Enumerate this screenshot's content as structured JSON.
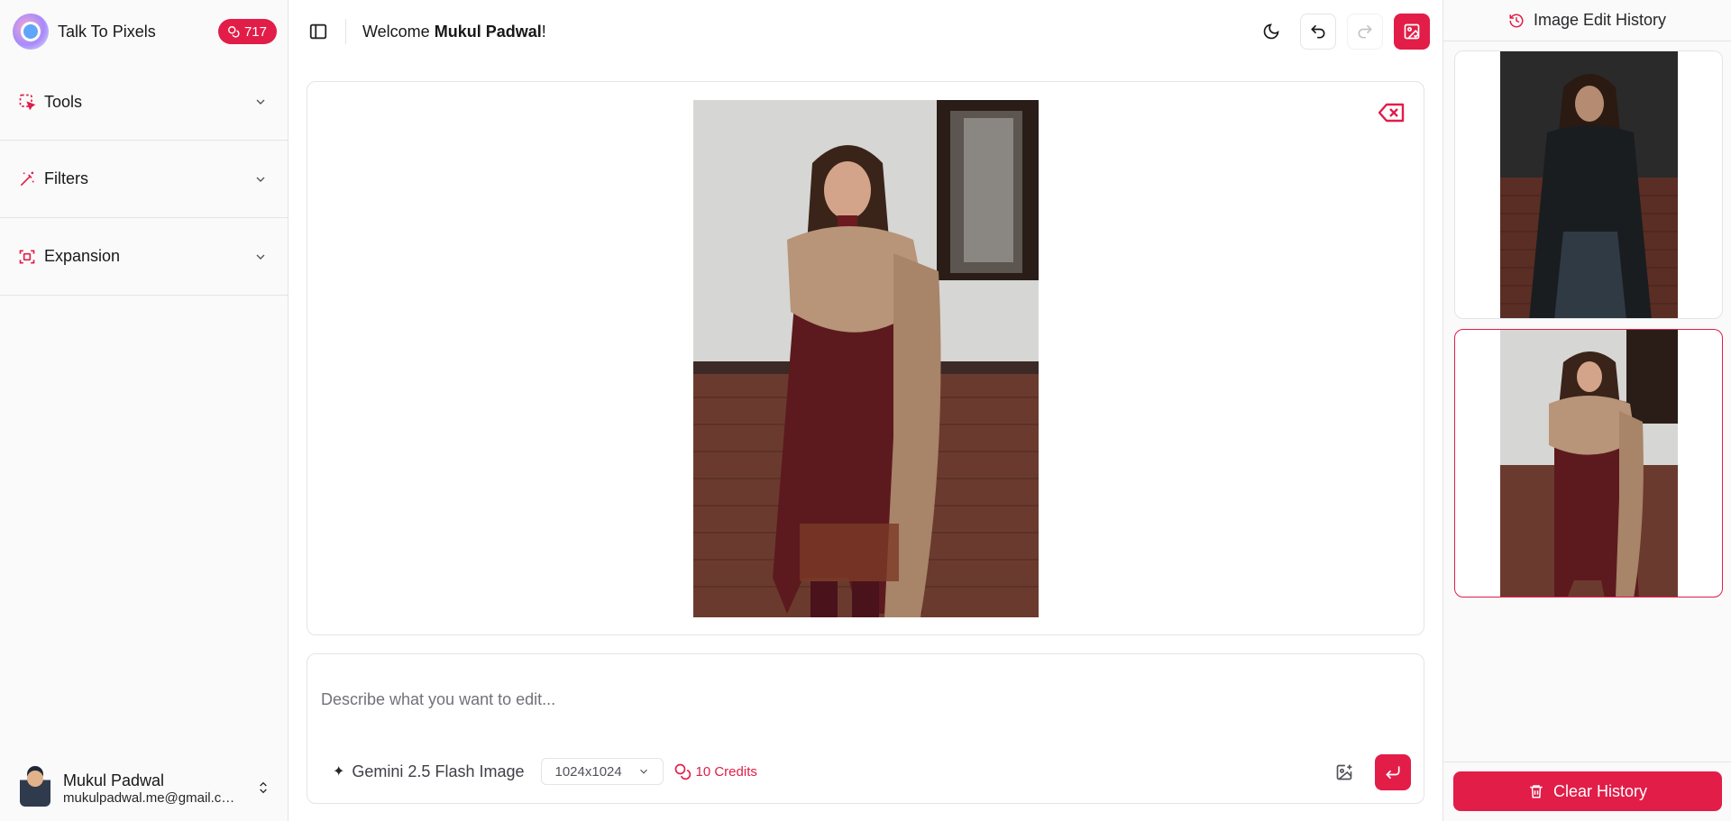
{
  "app": {
    "name": "Talk To Pixels",
    "credits_balance": "717"
  },
  "sidebar": {
    "sections": [
      {
        "label": "Tools",
        "icon": "selection-icon"
      },
      {
        "label": "Filters",
        "icon": "magic-wand-icon"
      },
      {
        "label": "Expansion",
        "icon": "expand-frame-icon"
      }
    ]
  },
  "user": {
    "name": "Mukul Padwal",
    "email": "mukulpadwal.me@gmail.com"
  },
  "header": {
    "welcome_prefix": "Welcome ",
    "welcome_name": "Mukul Padwal",
    "welcome_suffix": "!"
  },
  "prompt": {
    "placeholder": "Describe what you want to edit...",
    "model": "Gemini 2.5 Flash Image",
    "size": "1024x1024",
    "cost": "10 Credits"
  },
  "history": {
    "title": "Image Edit History",
    "items": [
      {
        "description": "woman in dark jacket",
        "selected": false
      },
      {
        "description": "woman in embroidered shawl",
        "selected": true
      }
    ],
    "clear_label": "Clear History"
  },
  "colors": {
    "accent": "#e11d48",
    "border": "#e4e4e7",
    "sidebar_bg": "#fafafa"
  }
}
